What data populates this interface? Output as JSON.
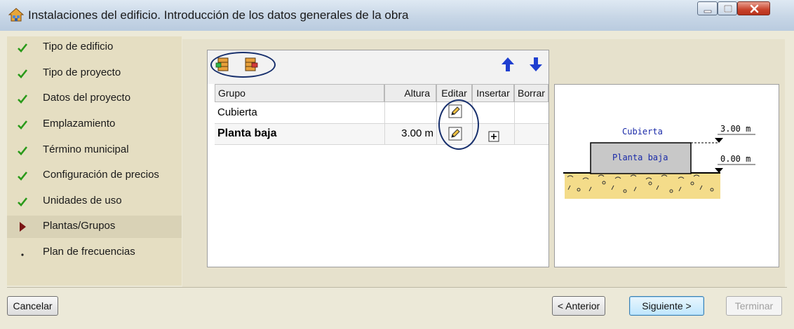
{
  "window": {
    "title": "Instalaciones del edificio. Introducción de los datos generales de la obra",
    "icon": "house-icon",
    "controls": [
      "minimize-icon",
      "maximize-icon",
      "close-icon"
    ]
  },
  "sidebar": {
    "items": [
      {
        "label": "Tipo de edificio",
        "status": "done"
      },
      {
        "label": "Tipo de proyecto",
        "status": "done"
      },
      {
        "label": "Datos del proyecto",
        "status": "done"
      },
      {
        "label": "Emplazamiento",
        "status": "done"
      },
      {
        "label": "Término municipal",
        "status": "done"
      },
      {
        "label": "Configuración de precios",
        "status": "done"
      },
      {
        "label": "Unidades de uso",
        "status": "done"
      },
      {
        "label": "Plantas/Grupos",
        "status": "current"
      },
      {
        "label": "Plan de frecuencias",
        "status": "pending"
      }
    ]
  },
  "table": {
    "toolbar": {
      "tools": [
        "add-floor-icon",
        "add-group-icon"
      ],
      "move": [
        "move-up-icon",
        "move-down-icon"
      ]
    },
    "columns": [
      "Grupo",
      "Altura",
      "Editar",
      "Insertar",
      "Borrar"
    ],
    "rows": [
      {
        "grupo": "Cubierta",
        "altura": "",
        "editar": true,
        "insertar": false,
        "bold": false
      },
      {
        "grupo": "Planta baja",
        "altura": "3.00 m",
        "editar": true,
        "insertar": true,
        "bold": true
      }
    ]
  },
  "preview": {
    "top_label": "Cubierta",
    "floor_label": "Planta baja",
    "top_level": "3.00 m",
    "base_level": "0.00 m"
  },
  "footer": {
    "cancel": "Cancelar",
    "prev": "< Anterior",
    "next": "Siguiente >",
    "finish": "Terminar"
  },
  "colors": {
    "check": "#2a9a1a",
    "current_arrow": "#7a1414",
    "annotation_oval": "#18306d",
    "arrow_blue": "#1f3fd0",
    "ground": "#f4dc8a",
    "floor_box": "#c8c8c8",
    "preview_text": "#1a2aa8"
  }
}
